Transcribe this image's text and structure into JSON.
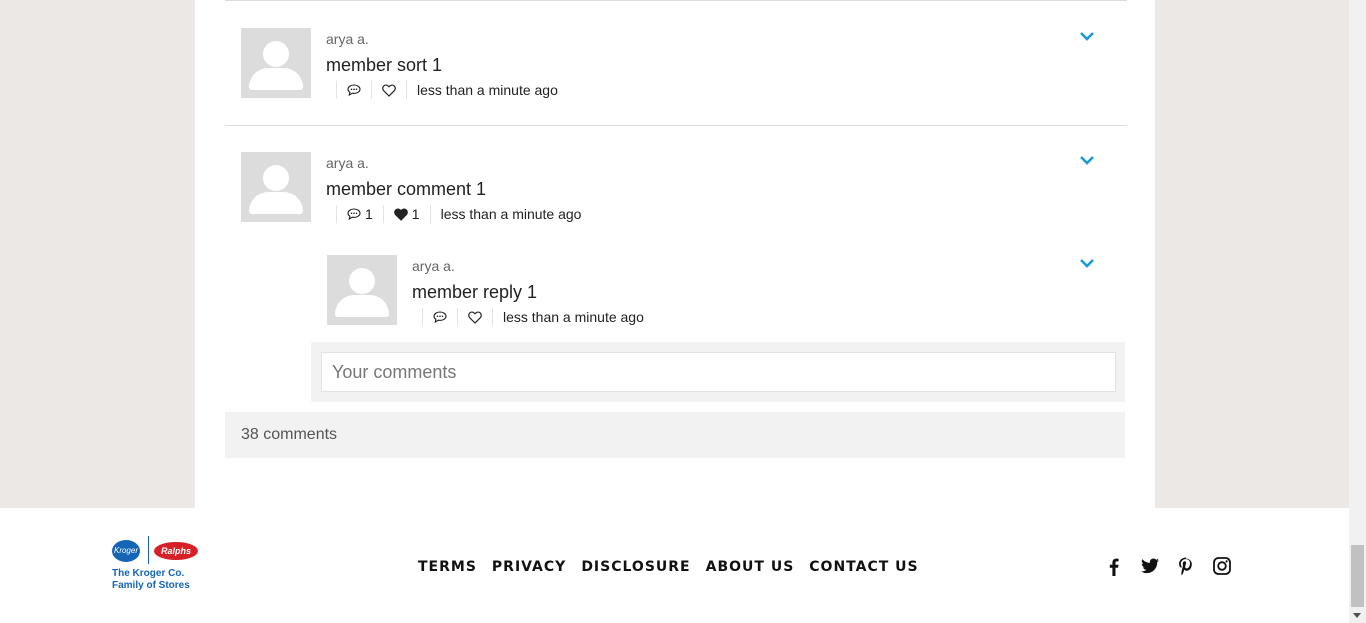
{
  "comments": [
    {
      "author": "arya a.",
      "text": "member sort 1",
      "reply_count": "",
      "like_count": "",
      "liked": false,
      "time": "less than a minute ago"
    },
    {
      "author": "arya a.",
      "text": "member comment 1",
      "reply_count": "1",
      "like_count": "1",
      "liked": true,
      "time": "less than a minute ago",
      "replies": [
        {
          "author": "arya a.",
          "text": "member reply 1",
          "reply_count": "",
          "like_count": "",
          "liked": false,
          "time": "less than a minute ago"
        }
      ]
    }
  ],
  "reply_input": {
    "placeholder": "Your comments",
    "value": ""
  },
  "comment_count": "38 comments",
  "footer": {
    "logo": {
      "kroger": "Kroger",
      "ralphs": "Ralphs",
      "tagline_line1": "The Kroger Co.",
      "tagline_line2": "Family of Stores"
    },
    "nav": [
      "TERMS",
      "PRIVACY",
      "DISCLOSURE",
      "ABOUT US",
      "CONTACT US"
    ],
    "social_icons": [
      "facebook-icon",
      "twitter-icon",
      "pinterest-icon",
      "instagram-icon"
    ]
  },
  "colors": {
    "accent": "#1a9ad6",
    "brand_blue": "#1565b7",
    "brand_red": "#d62128"
  }
}
